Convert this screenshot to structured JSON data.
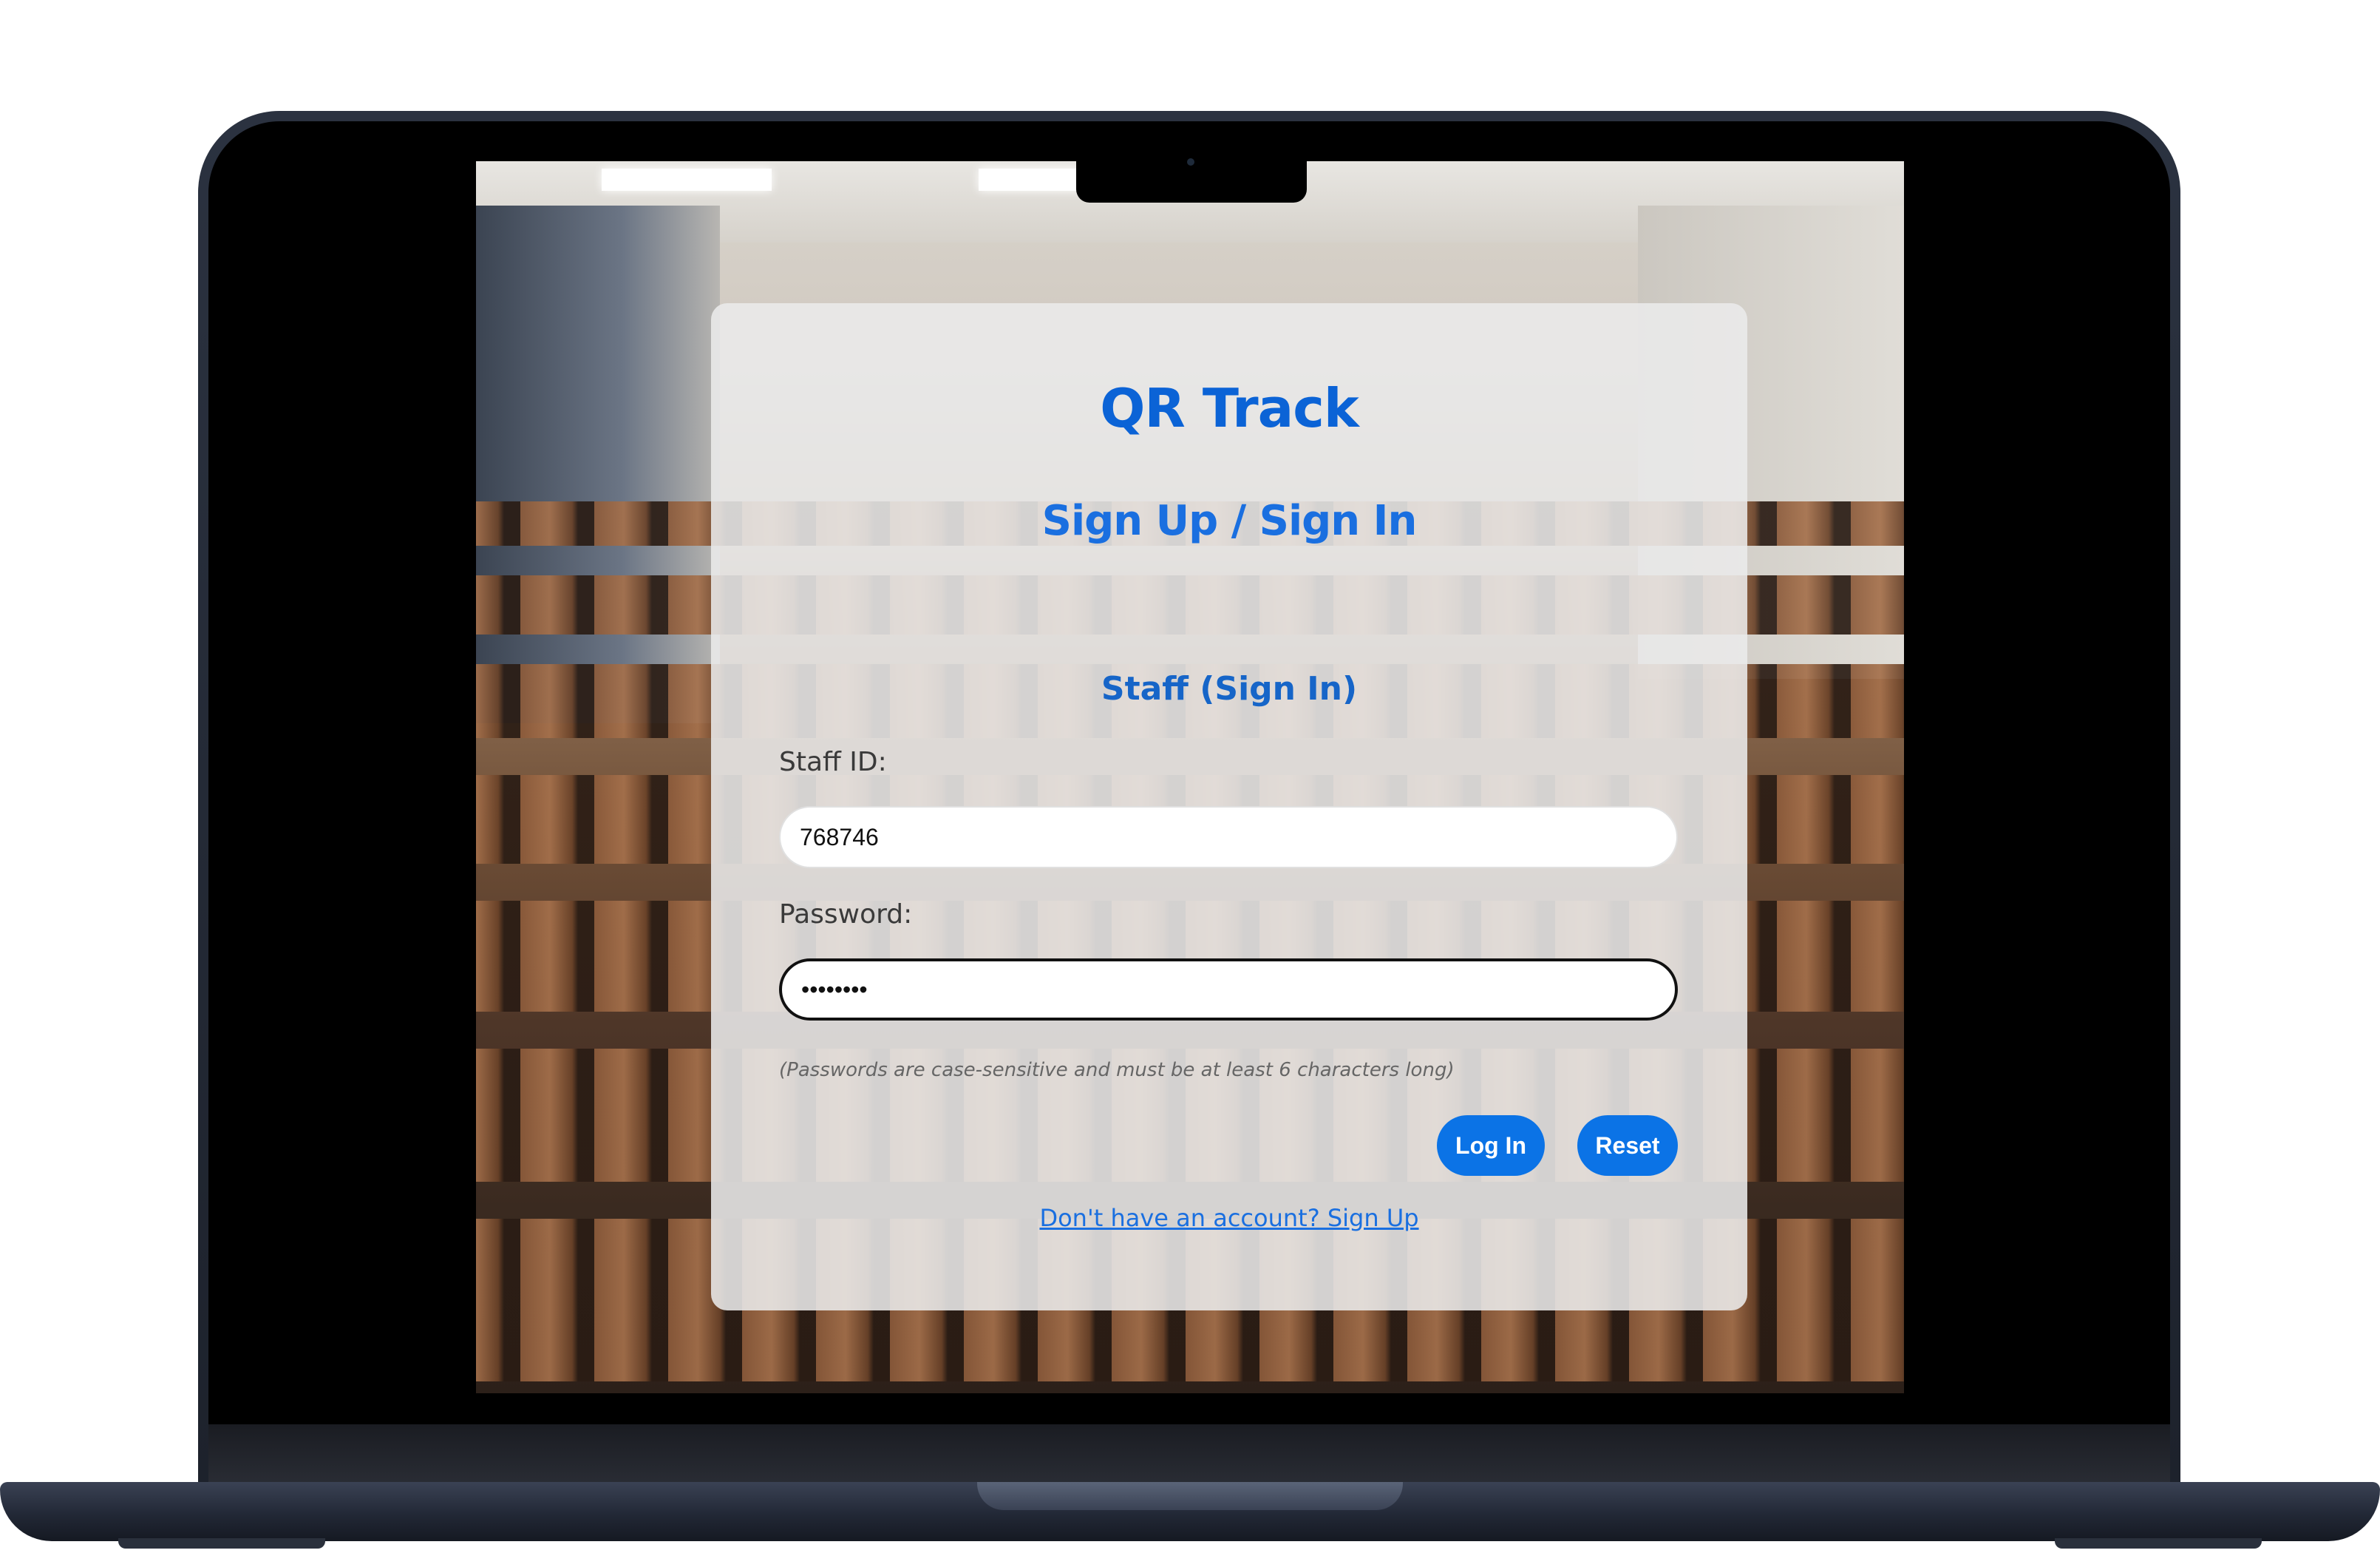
{
  "app": {
    "title": "QR Track",
    "section_title": "Sign Up / Sign In",
    "role_title": "Staff (Sign In)"
  },
  "form": {
    "staff_id_label": "Staff ID:",
    "staff_id_value": "768746",
    "password_label": "Password:",
    "password_value": "••••••••",
    "hint": "(Passwords are case-sensitive and must be at least 6 characters long)"
  },
  "actions": {
    "login_label": "Log In",
    "reset_label": "Reset",
    "signup_link": "Don't have an account? Sign Up"
  },
  "colors": {
    "primary": "#0b73e6",
    "title": "#0b63d6",
    "card_bg": "#ebebeb"
  }
}
